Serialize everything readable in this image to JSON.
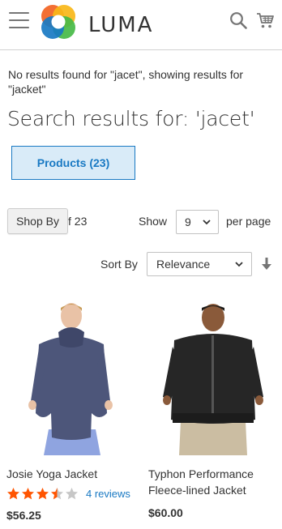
{
  "header": {
    "logo_text": "LUMA",
    "icons": {
      "menu": "hamburger-menu-icon",
      "search": "search-icon",
      "cart": "cart-icon"
    }
  },
  "notice": "No results found for \"jacet\", showing results for \"jacket\"",
  "page_title": "Search results for: 'jacet'",
  "tabs": [
    {
      "label": "Products (23)",
      "active": true
    }
  ],
  "toolbar": {
    "shop_by_label": "Shop By",
    "amount_text": "f 23",
    "show_label": "Show",
    "limiter_value": "9",
    "per_page_label": "per page",
    "sort_by_label": "Sort By",
    "sort_value": "Relevance",
    "sort_direction_icon": "arrow-down-icon"
  },
  "products": [
    {
      "name": "Josie Yoga Jacket",
      "rating_stars": 3.5,
      "reviews": "4 reviews",
      "price": "$56.25",
      "garment_color": "#4d567a"
    },
    {
      "name": "Typhon Performance Fleece-lined Jacket",
      "rating_stars": null,
      "reviews": "",
      "price": "$60.00",
      "garment_color": "#262626"
    }
  ],
  "colors": {
    "accent": "#1979c3",
    "tab_bg": "#d9ebf8",
    "star": "#ff5501",
    "star_empty": "#c7c7c7",
    "logo": [
      "#f26322",
      "#f8b718",
      "#47ba47",
      "#1979c3"
    ]
  }
}
